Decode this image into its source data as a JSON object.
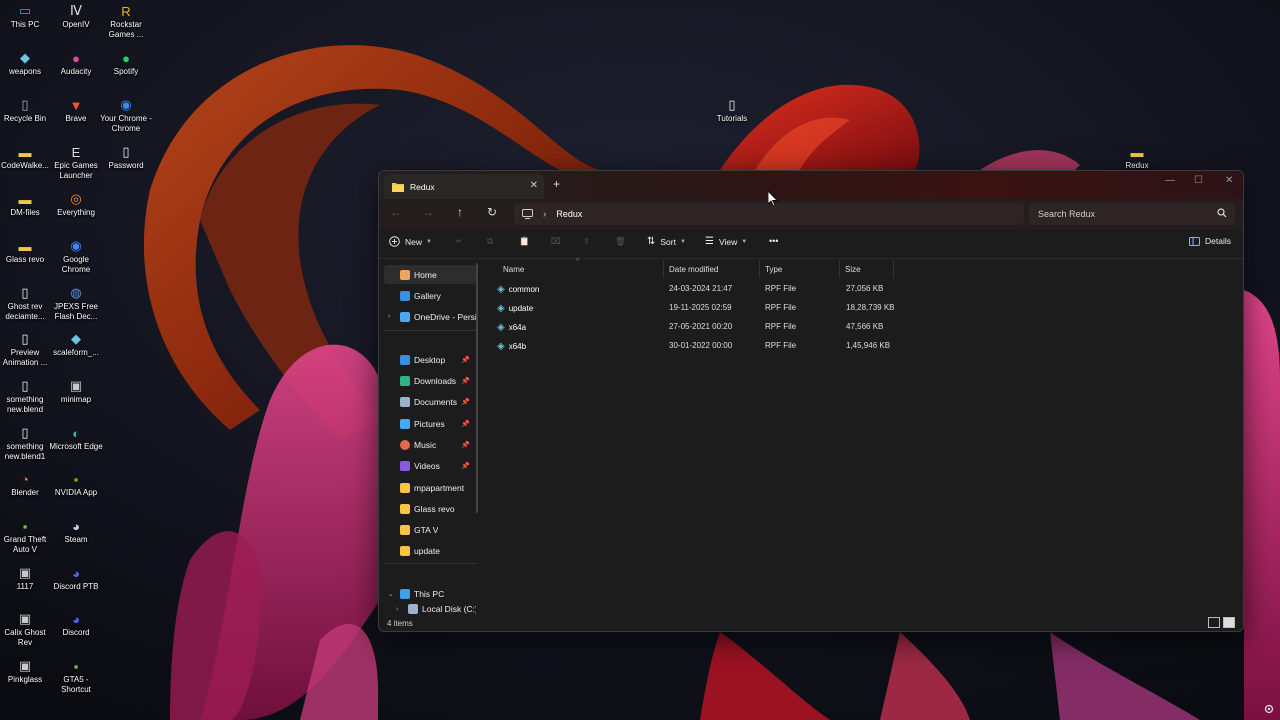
{
  "desktop": {
    "icons": [
      {
        "label": "This PC",
        "icon": "this-pc-icon"
      },
      {
        "label": "OpenIV",
        "icon": "openiv-icon"
      },
      {
        "label": "Rockstar Games ...",
        "icon": "rockstar-icon"
      },
      {
        "label": "weapons",
        "icon": "weapons-icon"
      },
      {
        "label": "Audacity",
        "icon": "audacity-icon"
      },
      {
        "label": "Spotify",
        "icon": "spotify-icon"
      },
      {
        "label": "Recycle Bin",
        "icon": "recycle-bin-icon"
      },
      {
        "label": "Brave",
        "icon": "brave-icon"
      },
      {
        "label": "Your Chrome - Chrome",
        "icon": "chrome-icon"
      },
      {
        "label": "CodeWalke...",
        "icon": "folder-icon"
      },
      {
        "label": "Epic Games Launcher",
        "icon": "epic-games-icon"
      },
      {
        "label": "Password",
        "icon": "document-icon"
      },
      {
        "label": "DM-files",
        "icon": "folder-icon"
      },
      {
        "label": "Everything",
        "icon": "everything-icon"
      },
      {
        "label": "Glass revo",
        "icon": "folder-icon"
      },
      {
        "label": "Google Chrome",
        "icon": "chrome-icon"
      },
      {
        "label": "Ghost rev deciamte...",
        "icon": "document-icon"
      },
      {
        "label": "JPEXS Free Flash Dec...",
        "icon": "jpexs-icon"
      },
      {
        "label": "Preview Animation ...",
        "icon": "document-icon"
      },
      {
        "label": "scaleform_...",
        "icon": "scaleform-icon"
      },
      {
        "label": "something new.blend",
        "icon": "document-icon"
      },
      {
        "label": "minimap",
        "icon": "image-icon"
      },
      {
        "label": "something new.blend1",
        "icon": "document-icon"
      },
      {
        "label": "Microsoft Edge",
        "icon": "edge-icon"
      },
      {
        "label": "Blender",
        "icon": "blender-icon"
      },
      {
        "label": "NVIDIA App",
        "icon": "nvidia-icon"
      },
      {
        "label": "Grand Theft Auto V",
        "icon": "gta-icon"
      },
      {
        "label": "Steam",
        "icon": "steam-icon"
      },
      {
        "label": "1117",
        "icon": "image-icon"
      },
      {
        "label": "Discord PTB",
        "icon": "discord-icon"
      },
      {
        "label": "Calix Ghost Rev",
        "icon": "image-icon"
      },
      {
        "label": "Discord",
        "icon": "discord-icon"
      },
      {
        "label": "Pinkglass",
        "icon": "image-icon"
      },
      {
        "label": "GTA5 - Shortcut",
        "icon": "gta-icon"
      },
      {
        "label": "Tutorials",
        "icon": "document-icon"
      },
      {
        "label": "Redux",
        "icon": "folder-icon"
      }
    ]
  },
  "window": {
    "tab_title": "Redux",
    "new_tab": "+",
    "controls": {
      "minimize": "—",
      "maximize": "☐",
      "close": "✕"
    }
  },
  "address": {
    "crumb": "Redux",
    "search_placeholder": "Search Redux"
  },
  "toolbar": {
    "new_label": "New",
    "sort_label": "Sort",
    "view_label": "View",
    "more_label": "•••",
    "details_label": "Details"
  },
  "sidebar": {
    "items": [
      {
        "label": "Home",
        "icon": "home-icon",
        "pinned": false
      },
      {
        "label": "Gallery",
        "icon": "gallery-icon",
        "pinned": false
      },
      {
        "label": "OneDrive - Persi",
        "icon": "onedrive-icon",
        "pinned": false
      },
      {
        "label": "Desktop",
        "icon": "desktop-icon",
        "pinned": true
      },
      {
        "label": "Downloads",
        "icon": "downloads-icon",
        "pinned": true
      },
      {
        "label": "Documents",
        "icon": "documents-icon",
        "pinned": true
      },
      {
        "label": "Pictures",
        "icon": "pictures-icon",
        "pinned": true
      },
      {
        "label": "Music",
        "icon": "music-icon",
        "pinned": true
      },
      {
        "label": "Videos",
        "icon": "videos-icon",
        "pinned": true
      },
      {
        "label": "mpapartment",
        "icon": "folder-icon",
        "pinned": false
      },
      {
        "label": "Glass revo",
        "icon": "folder-icon",
        "pinned": false
      },
      {
        "label": "GTA V",
        "icon": "folder-icon",
        "pinned": false
      },
      {
        "label": "update",
        "icon": "folder-icon",
        "pinned": false
      },
      {
        "label": "This PC",
        "icon": "this-pc-icon",
        "pinned": false
      },
      {
        "label": "Local Disk (C:)",
        "icon": "disk-icon",
        "pinned": false
      }
    ]
  },
  "files": {
    "columns": [
      "Name",
      "Date modified",
      "Type",
      "Size"
    ],
    "rows": [
      {
        "name": "common",
        "date": "24-03-2024 21:47",
        "type": "RPF File",
        "size": "27,056 KB"
      },
      {
        "name": "update",
        "date": "19-11-2025 02:59",
        "type": "RPF File",
        "size": "18,28,739 KB"
      },
      {
        "name": "x64a",
        "date": "27-05-2021 00:20",
        "type": "RPF File",
        "size": "47,566 KB"
      },
      {
        "name": "x64b",
        "date": "30-01-2022 00:00",
        "type": "RPF File",
        "size": "1,45,946 KB"
      }
    ]
  },
  "status": {
    "count": "4 items"
  }
}
